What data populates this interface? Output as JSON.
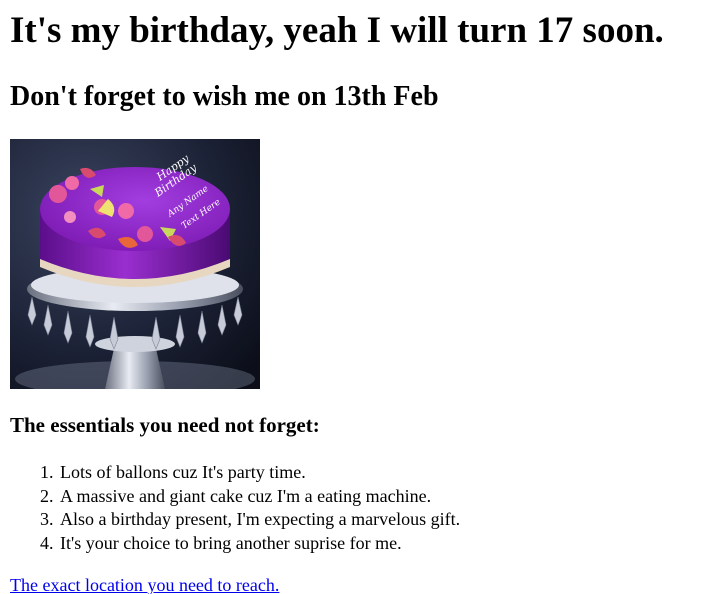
{
  "page": {
    "heading": "It's my birthday, yeah I will turn 17 soon.",
    "subheading": "Don't forget to wish me on 13th Feb",
    "essentials_title": "The essentials you need not forget:",
    "list": [
      {
        "number": "1.",
        "text": "Lots of ballons cuz It's party time."
      },
      {
        "number": "2.",
        "text": "A massive and giant cake cuz I'm a eating machine."
      },
      {
        "number": "3.",
        "text": "Also a birthday present, I'm expecting a marvelous gift."
      },
      {
        "number": "4.",
        "text": "It's your choice to bring another suprise for me."
      }
    ],
    "link_part1": "The exact location",
    "link_part2": "you need to reach."
  },
  "cake_image": {
    "text_line1": "Happy",
    "text_line2": "Birthday",
    "text_line3": "Any Name",
    "text_line4": "Text Here",
    "colors": {
      "icing": "#8a1fc0",
      "icing_dark": "#5b0e8a",
      "background": "#1c2236",
      "stand": "#c8ccd8"
    }
  }
}
